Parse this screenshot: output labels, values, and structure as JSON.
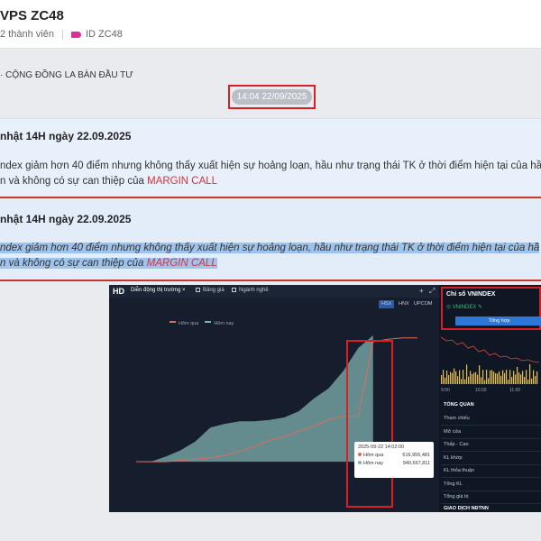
{
  "header": {
    "title": "VPS ZC48",
    "members": "2 thành viên",
    "group_id": "ID ZC48"
  },
  "channel": {
    "name": "· CỘNG ĐỒNG LA BÀN ĐẦU TƯ"
  },
  "timestamp": "14:04 22/09/2025",
  "messages": [
    {
      "title": "nhật 14H ngày 22.09.2025",
      "line1": "ndex giảm hơn 40 điểm nhưng không thấy xuất hiện sự hoảng loạn, hầu như trạng thái TK ở thời điểm hiện tại của hầ",
      "line2_prefix": "n và không có sự can thiệp của ",
      "line2_emphasis": "MARGIN CALL"
    },
    {
      "title": "nhật 14H ngày 22.09.2025",
      "line1": "ndex giảm hơn 40 điểm nhưng không thấy xuất hiện sự hoảng loạn, hầu như trạng thái TK ở thời điểm hiện tại của hầ",
      "line2_prefix": "n và không có sự can thiệp của ",
      "line2_emphasis": "MARGIN CALL"
    }
  ],
  "screenshot": {
    "hd_badge": "HD",
    "tabs": [
      "Diễn động thị trường",
      "Bảng giá",
      "Ngành nghề"
    ],
    "tab_close": "×",
    "add_icon": "+",
    "expand_icon": "⤢",
    "exchanges": [
      "HSX",
      "HNX",
      "UPCOM"
    ],
    "legend": [
      "Hôm qua",
      "Hôm nay"
    ],
    "tooltip": {
      "time": "2025-09-22 14:02:00",
      "rows": [
        {
          "label": "Hôm qua",
          "value": "616,955,481"
        },
        {
          "label": "Hôm nay",
          "value": "940,667,811"
        }
      ]
    },
    "series_colors": {
      "hom_qua": "#e06a5e",
      "hom_nay": "#7fb2b0"
    },
    "chart_data": {
      "type": "area",
      "series": [
        {
          "name": "Hôm qua",
          "values": [
            0,
            0,
            0,
            1,
            2,
            3,
            5,
            8,
            12,
            17,
            20,
            24,
            28,
            33,
            36,
            36,
            95,
            97,
            98,
            98
          ]
        },
        {
          "name": "Hôm nay",
          "values": [
            0,
            0,
            4,
            9,
            16,
            27,
            30,
            32,
            32,
            33,
            35,
            40,
            50,
            58,
            72,
            90,
            100
          ]
        }
      ]
    },
    "vnindex_panel": {
      "title": "Chỉ số VNINDEX",
      "symbol": "VNINDEX",
      "button": "Tổng hợp",
      "time_labels": [
        "9:00",
        "10:00",
        "11:00"
      ],
      "overview_title": "TỔNG QUAN",
      "rows": [
        "Tham chiếu",
        "Mở cửa",
        "Thấp - Cao",
        "KL khớp",
        "KL thỏa thuận",
        "Tổng KL",
        "Tổng giá trị"
      ],
      "footer": "GIAO DỊCH NĐTNN"
    }
  }
}
